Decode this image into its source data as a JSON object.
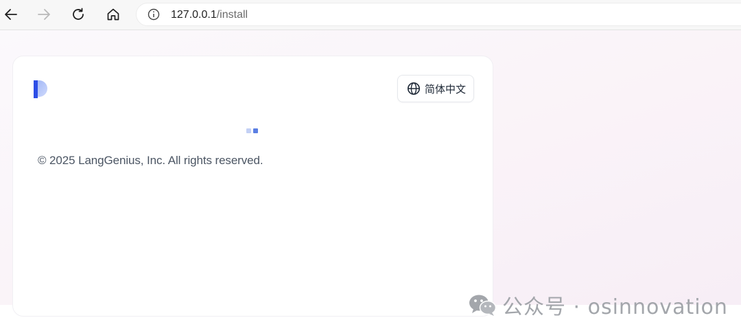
{
  "browser": {
    "back_icon": "arrow-left-icon",
    "forward_icon": "arrow-right-icon",
    "reload_icon": "reload-icon",
    "home_icon": "home-icon",
    "info_icon": "info-circle-icon",
    "url_host": "127.0.0.1",
    "url_path": "/install"
  },
  "card": {
    "logo": "dify-logo",
    "language_button": {
      "icon": "globe-icon",
      "label": "简体中文"
    },
    "loader_colors": [
      "#c3d0f5",
      "#5b7fe3"
    ],
    "copyright": "© 2025 LangGenius, Inc. All rights reserved."
  },
  "watermark": {
    "icon": "wechat-icon",
    "text": "公众号 · osinnovation"
  },
  "colors": {
    "logo_blue": "#2d4ee6",
    "page_tint": "#f7eef6"
  }
}
